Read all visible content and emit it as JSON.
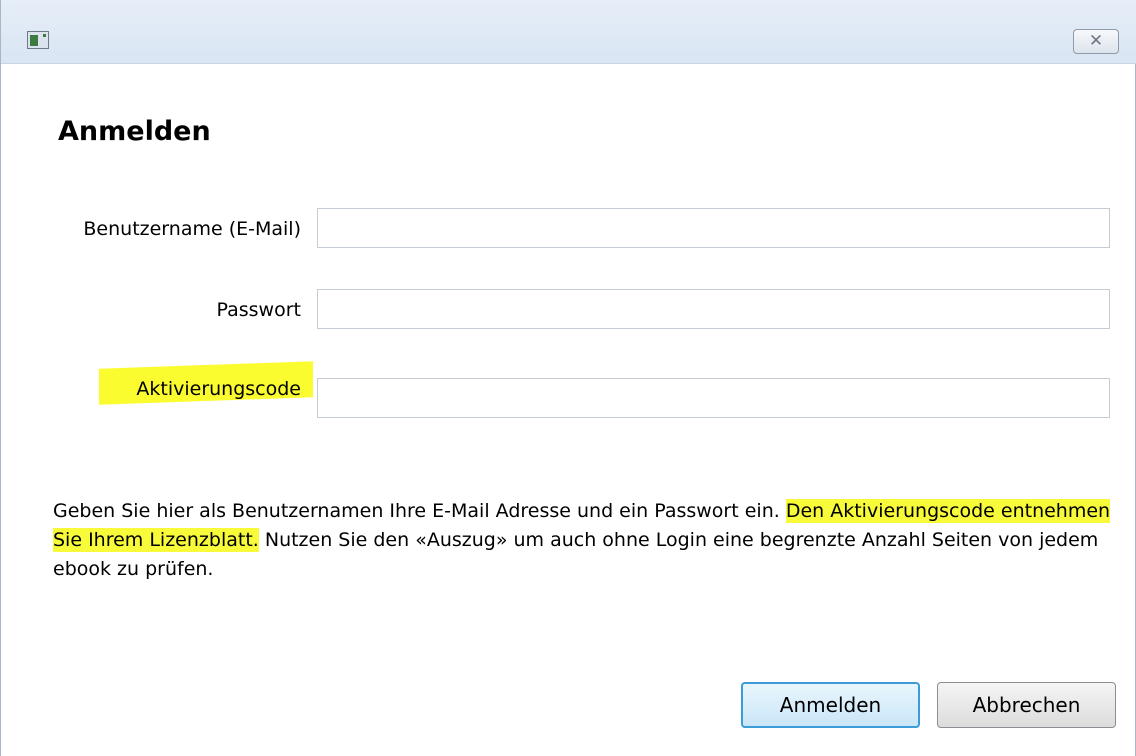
{
  "window": {
    "title": "",
    "close_glyph": "✕"
  },
  "form": {
    "heading": "Anmelden",
    "username_label": "Benutzername (E-Mail)",
    "username_value": "",
    "password_label": "Passwort",
    "password_value": "",
    "activation_label": "Aktivierungscode",
    "activation_value": ""
  },
  "info": {
    "text_1": "Geben Sie hier als Benutzernamen Ihre E-Mail Adresse und ein Passwort ein. ",
    "highlight": "Den Aktivierungscode entnehmen Sie Ihrem Lizenzblatt.",
    "text_2": " Nutzen Sie den «Auszug» um auch ohne Login eine begrenzte Anzahl Seiten von jedem ebook zu prüfen."
  },
  "buttons": {
    "login": "Anmelden",
    "cancel": "Abbrechen"
  },
  "colors": {
    "highlight": "#fbfc2f",
    "default_button_border": "#3c9bd9"
  }
}
